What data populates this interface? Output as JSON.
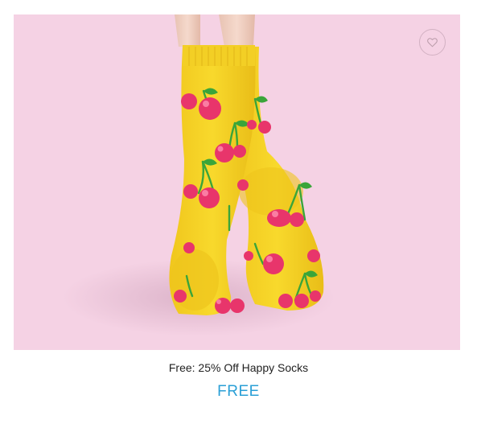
{
  "product": {
    "title": "Free: 25% Off Happy Socks",
    "price": "FREE",
    "image_subject": "yellow-cherry-socks"
  },
  "wishlist": {
    "icon": "heart-outline-icon"
  },
  "colors": {
    "image_background": "#f5d2e4",
    "price_accent": "#2a9fd6",
    "sock_yellow": "#f7d428",
    "cherry_pink": "#e8356b"
  }
}
